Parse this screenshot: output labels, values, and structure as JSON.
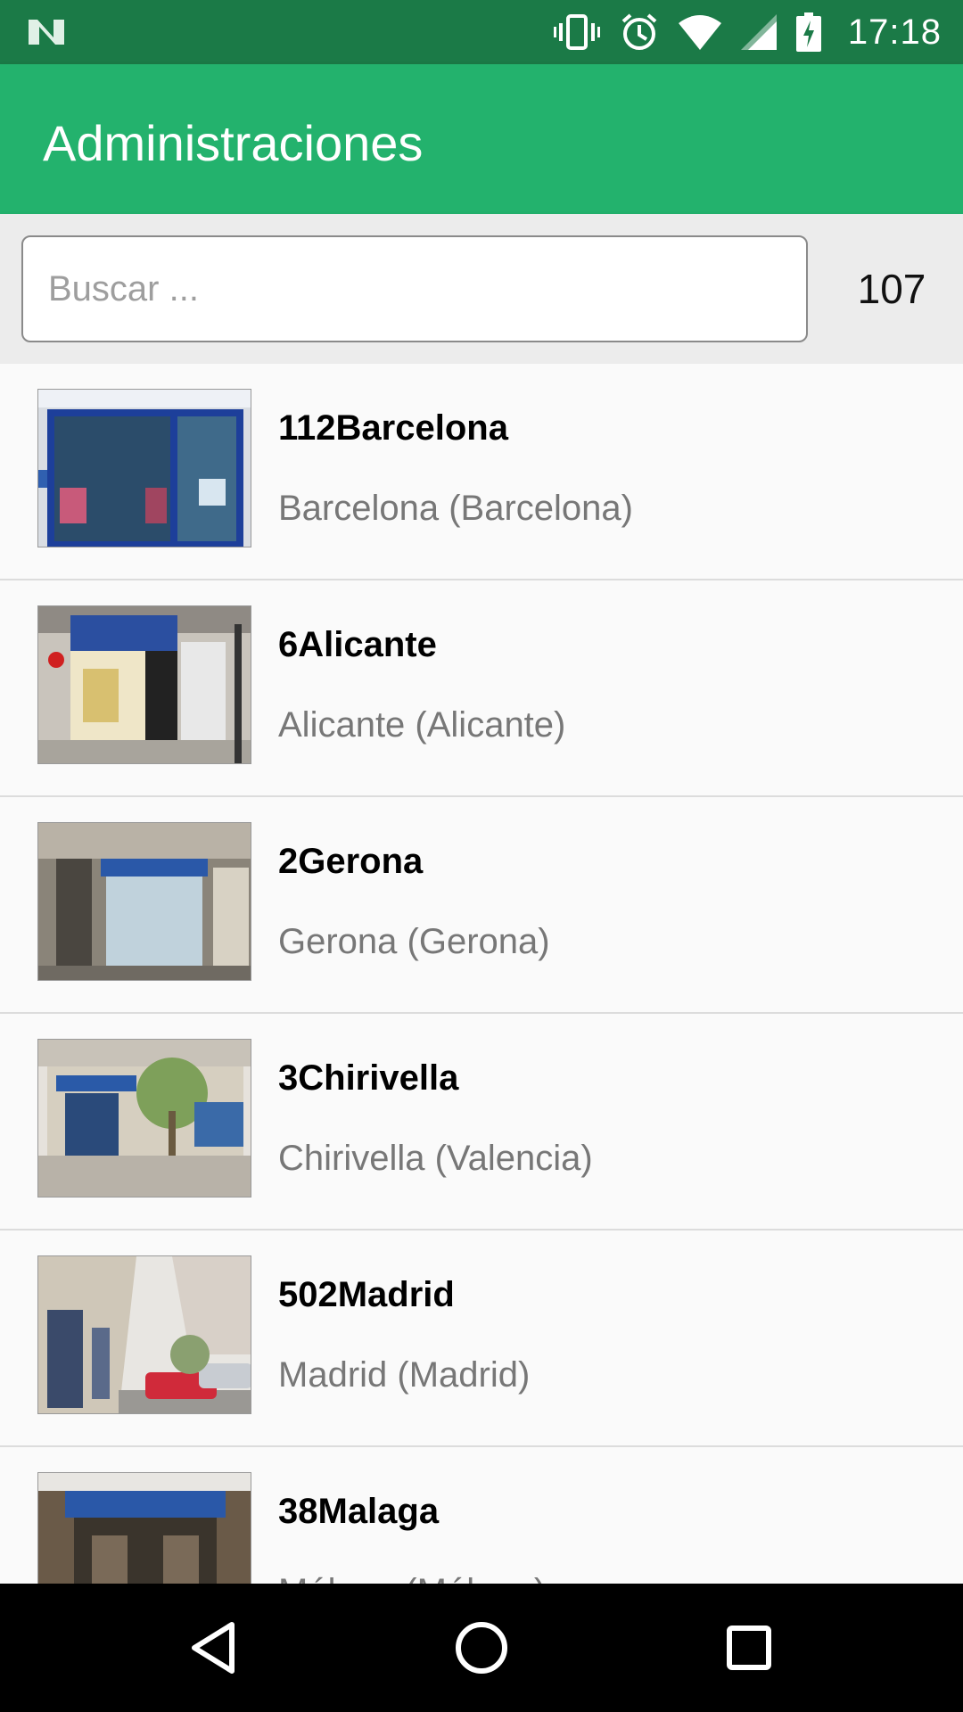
{
  "status_bar": {
    "time": "17:18",
    "icons": [
      "n-logo-icon",
      "vibrate-icon",
      "alarm-icon",
      "wifi-icon",
      "signal-icon",
      "battery-charging-icon"
    ]
  },
  "app_bar": {
    "title": "Administraciones"
  },
  "search": {
    "placeholder": "Buscar ...",
    "value": "",
    "result_count": "107"
  },
  "colors": {
    "status_bar": "#1b7a47",
    "app_bar": "#23b26d",
    "list_background": "#fafafa",
    "subtitle_text": "#777777"
  },
  "items": [
    {
      "title": "112Barcelona",
      "subtitle": "Barcelona (Barcelona)",
      "thumbnail": "lottery-shop-photo"
    },
    {
      "title": "6Alicante",
      "subtitle": "Alicante (Alicante)",
      "thumbnail": "lottery-shop-photo"
    },
    {
      "title": "2Gerona",
      "subtitle": "Gerona (Gerona)",
      "thumbnail": "lottery-shop-photo"
    },
    {
      "title": "3Chirivella",
      "subtitle": "Chirivella (Valencia)",
      "thumbnail": "lottery-shop-photo"
    },
    {
      "title": "502Madrid",
      "subtitle": "Madrid (Madrid)",
      "thumbnail": "street-photo"
    },
    {
      "title": "38Malaga",
      "subtitle": "Málaga (Málaga)",
      "thumbnail": "lottery-shop-photo"
    }
  ],
  "nav_bar": {
    "icons": [
      "back-triangle-icon",
      "home-circle-icon",
      "recents-square-icon"
    ]
  }
}
